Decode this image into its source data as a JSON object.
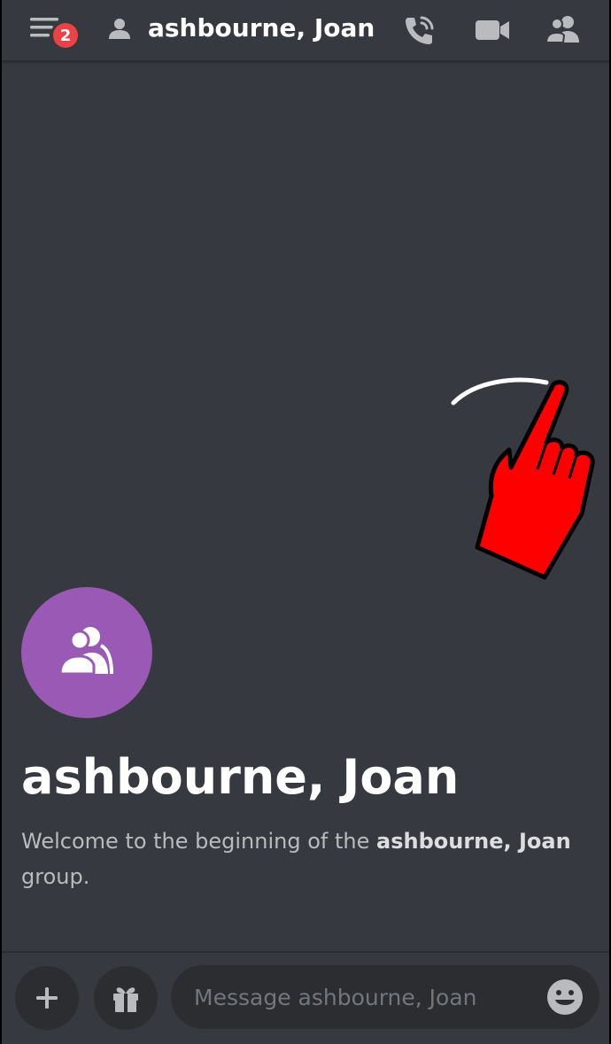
{
  "header": {
    "notification_count": "2",
    "title": "ashbourne, Joan",
    "icons": [
      "menu-icon",
      "user-icon",
      "phone-call-icon",
      "video-camera-icon",
      "members-icon"
    ]
  },
  "welcome": {
    "group_name": "ashbourne, Joan",
    "intro_text": "Welcome to the beginning of the ",
    "intro_bold": "ashbourne, Joan",
    "intro_suffix": "group."
  },
  "composer": {
    "placeholder": "Message ashbourne, Joan"
  },
  "colors": {
    "background": "#36393f",
    "avatar": "#9b59b6",
    "badge": "#ed4245",
    "input_bg": "#2b2d31",
    "pointer": "#ff0000"
  }
}
